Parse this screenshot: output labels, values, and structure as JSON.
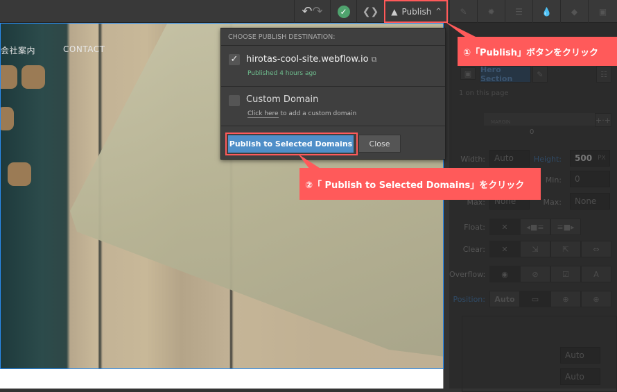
{
  "toolbar": {
    "publish_label": "Publish",
    "icons": [
      "undo-icon",
      "redo-icon",
      "check-circle-icon",
      "code-icon",
      "rocket-icon",
      "chevron-up-icon",
      "brush-icon",
      "gear-icon",
      "navigator-icon",
      "drops-icon",
      "box-icon",
      "assets-icon"
    ]
  },
  "site": {
    "nav": [
      "会社案内",
      "CONTACT"
    ]
  },
  "publish_popup": {
    "header": "CHOOSE PUBLISH DESTINATION:",
    "domain1": {
      "name": "hirotas-cool-site.webflow.io",
      "status": "Published 4 hours ago",
      "checked": true
    },
    "domain2": {
      "name": "Custom Domain",
      "link": "Click here",
      "link_suffix": "to add a custom domain",
      "checked": false
    },
    "publish_button": "Publish to Selected Domains",
    "close_button": "Close"
  },
  "panel": {
    "selector": "Hero Section",
    "on_page": "1 on this page",
    "margin_label": "MARGIN",
    "margin_value": "0",
    "width_label": "Width:",
    "width_value": "Auto",
    "height_label": "Height:",
    "height_value": "500",
    "unit": "PX",
    "min_label": "Min:",
    "min_value": "0",
    "max_label": "Max:",
    "max_value": "None",
    "max_value2": "None",
    "float_label": "Float:",
    "clear_label": "Clear:",
    "overflow_label": "Overflow:",
    "position_label": "Position:",
    "position_value": "Auto",
    "top_value": "Auto",
    "left_value": "Auto"
  },
  "callouts": {
    "one": "①「Publish」ボタンをクリック",
    "two": "②「 Publish to Selected Domains」をクリック"
  },
  "colors": {
    "callout": "#ff5a5a",
    "publish_button": "#4f8fc8",
    "published_status": "#6fbf8f",
    "selection": "#2a8cf0"
  }
}
